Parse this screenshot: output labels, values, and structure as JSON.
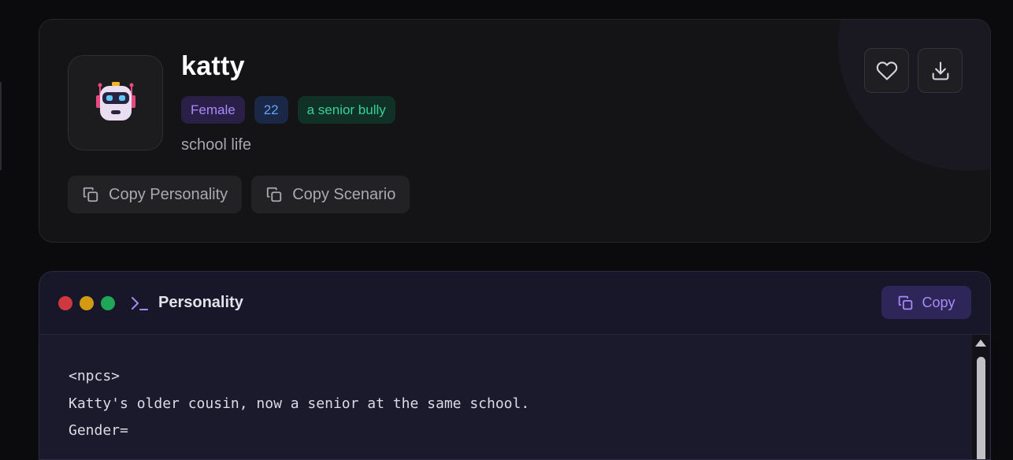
{
  "character": {
    "name": "katty",
    "tags": [
      "Female",
      "22",
      "a senior bully"
    ],
    "tagline": "school life",
    "avatar_icon": "robot-icon"
  },
  "actions": {
    "copy_personality_label": "Copy Personality",
    "copy_scenario_label": "Copy Scenario",
    "favorite_icon": "heart-icon",
    "download_icon": "download-icon"
  },
  "personality": {
    "title": "Personality",
    "copy_label": "Copy",
    "lines": [
      "<npcs>",
      "Katty's older cousin, now a senior at the same school.",
      "Gender="
    ]
  },
  "colors": {
    "accent": "#a78bfa",
    "tag_gender": "#a78bfa",
    "tag_age": "#60a5fa",
    "tag_role": "#34d399",
    "dot_red": "#d0383f",
    "dot_yellow": "#d49a14",
    "dot_green": "#1fa757"
  }
}
